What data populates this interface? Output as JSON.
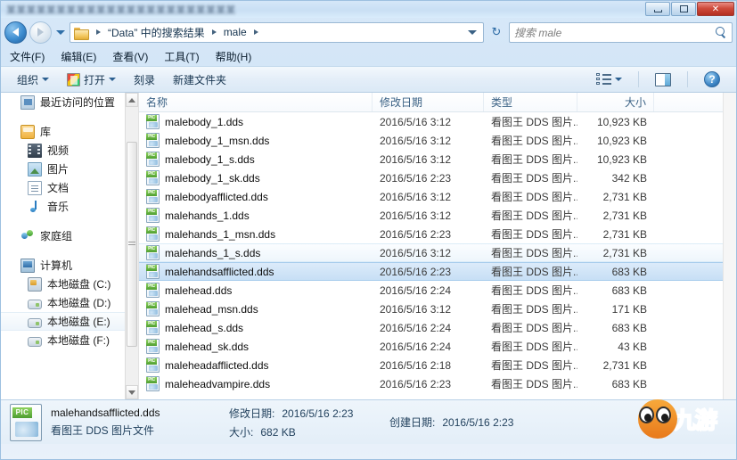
{
  "window": {
    "title_blurred": "某某某某某某某某某某某某某某某某某某某某某某某",
    "controls": {
      "minimize": "最小化",
      "maximize": "最大化",
      "close": "✕"
    }
  },
  "address_bar": {
    "back_tooltip": "后退",
    "forward_tooltip": "前进",
    "history_tooltip": "最近访问的位置",
    "breadcrumbs": [
      "“Data” 中的搜索结果",
      "male"
    ],
    "refresh_label": "↻"
  },
  "search": {
    "placeholder": "搜索 male",
    "icon": "search-icon"
  },
  "menu": {
    "items": [
      {
        "label": "文件(F)",
        "accel": "F"
      },
      {
        "label": "编辑(E)",
        "accel": "E"
      },
      {
        "label": "查看(V)",
        "accel": "V"
      },
      {
        "label": "工具(T)",
        "accel": "T"
      },
      {
        "label": "帮助(H)",
        "accel": "H"
      }
    ]
  },
  "toolbar": {
    "organize": "组织",
    "open": "打开",
    "burn": "刻录",
    "new_folder": "新建文件夹",
    "view_icon": "list-view-icon",
    "preview_icon": "preview-pane-icon",
    "help_icon": "help-icon"
  },
  "sidebar": {
    "items": [
      {
        "label": "最近访问的位置",
        "icon": "recent-places-icon",
        "level": "top"
      },
      {
        "label": "库",
        "icon": "library-icon",
        "level": "top"
      },
      {
        "label": "视频",
        "icon": "video-icon",
        "level": "child"
      },
      {
        "label": "图片",
        "icon": "pictures-icon",
        "level": "child"
      },
      {
        "label": "文档",
        "icon": "documents-icon",
        "level": "child"
      },
      {
        "label": "音乐",
        "icon": "music-icon",
        "level": "child"
      },
      {
        "label": "家庭组",
        "icon": "homegroup-icon",
        "level": "top"
      },
      {
        "label": "计算机",
        "icon": "computer-icon",
        "level": "top"
      },
      {
        "label": "本地磁盘 (C:)",
        "icon": "system-drive-icon",
        "level": "child"
      },
      {
        "label": "本地磁盘 (D:)",
        "icon": "drive-icon",
        "level": "child"
      },
      {
        "label": "本地磁盘 (E:)",
        "icon": "drive-icon",
        "level": "child",
        "selected": true
      },
      {
        "label": "本地磁盘 (F:)",
        "icon": "drive-icon",
        "level": "child"
      }
    ]
  },
  "file_list": {
    "columns": [
      "名称",
      "修改日期",
      "类型",
      "大小"
    ],
    "rows": [
      {
        "name": "malebody_1.dds",
        "date": "2016/5/16 3:12",
        "type": "看图王 DDS 图片...",
        "size": "10,923 KB",
        "state": ""
      },
      {
        "name": "malebody_1_msn.dds",
        "date": "2016/5/16 3:12",
        "type": "看图王 DDS 图片...",
        "size": "10,923 KB",
        "state": ""
      },
      {
        "name": "malebody_1_s.dds",
        "date": "2016/5/16 3:12",
        "type": "看图王 DDS 图片...",
        "size": "10,923 KB",
        "state": ""
      },
      {
        "name": "malebody_1_sk.dds",
        "date": "2016/5/16 2:23",
        "type": "看图王 DDS 图片...",
        "size": "342 KB",
        "state": ""
      },
      {
        "name": "malebodyafflicted.dds",
        "date": "2016/5/16 3:12",
        "type": "看图王 DDS 图片...",
        "size": "2,731 KB",
        "state": ""
      },
      {
        "name": "malehands_1.dds",
        "date": "2016/5/16 3:12",
        "type": "看图王 DDS 图片...",
        "size": "2,731 KB",
        "state": ""
      },
      {
        "name": "malehands_1_msn.dds",
        "date": "2016/5/16 2:23",
        "type": "看图王 DDS 图片...",
        "size": "2,731 KB",
        "state": ""
      },
      {
        "name": "malehands_1_s.dds",
        "date": "2016/5/16 3:12",
        "type": "看图王 DDS 图片...",
        "size": "2,731 KB",
        "state": "hover"
      },
      {
        "name": "malehandsafflicted.dds",
        "date": "2016/5/16 2:23",
        "type": "看图王 DDS 图片...",
        "size": "683 KB",
        "state": "selected"
      },
      {
        "name": "malehead.dds",
        "date": "2016/5/16 2:24",
        "type": "看图王 DDS 图片...",
        "size": "683 KB",
        "state": ""
      },
      {
        "name": "malehead_msn.dds",
        "date": "2016/5/16 3:12",
        "type": "看图王 DDS 图片...",
        "size": "171 KB",
        "state": ""
      },
      {
        "name": "malehead_s.dds",
        "date": "2016/5/16 2:24",
        "type": "看图王 DDS 图片...",
        "size": "683 KB",
        "state": ""
      },
      {
        "name": "malehead_sk.dds",
        "date": "2016/5/16 2:24",
        "type": "看图王 DDS 图片...",
        "size": "43 KB",
        "state": ""
      },
      {
        "name": "maleheadafflicted.dds",
        "date": "2016/5/16 2:18",
        "type": "看图王 DDS 图片...",
        "size": "2,731 KB",
        "state": ""
      },
      {
        "name": "maleheadvampire.dds",
        "date": "2016/5/16 2:23",
        "type": "看图王 DDS 图片...",
        "size": "683 KB",
        "state": ""
      }
    ]
  },
  "details_pane": {
    "file_name": "malehandsafflicted.dds",
    "modified_label": "修改日期:",
    "modified_value": "2016/5/16 2:23",
    "created_label": "创建日期:",
    "created_value": "2016/5/16 2:23",
    "type_value": "看图王 DDS 图片文件",
    "size_label": "大小:",
    "size_value": "682 KB"
  },
  "watermark": {
    "text": "九游"
  },
  "colors": {
    "selection_blue": "#c7dff5",
    "chrome_blue": "#cfe2f5",
    "close_red": "#b32f21",
    "pic_green": "#4e9e31",
    "accent_text": "#3b6285"
  }
}
